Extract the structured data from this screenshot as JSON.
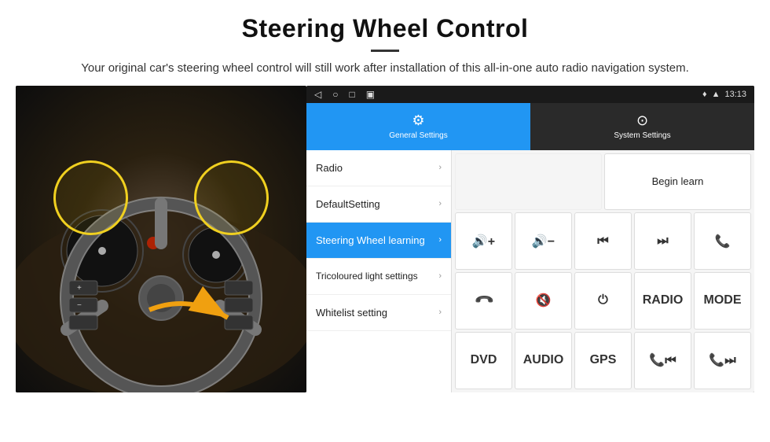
{
  "header": {
    "title": "Steering Wheel Control",
    "subtitle": "Your original car's steering wheel control will still work after installation of this all-in-one auto radio navigation system."
  },
  "statusbar": {
    "time": "13:13",
    "icons": [
      "◁",
      "○",
      "□",
      "▣"
    ]
  },
  "tabs": [
    {
      "label": "General Settings",
      "icon": "⚙",
      "active": true
    },
    {
      "label": "System Settings",
      "icon": "🔧",
      "active": false
    }
  ],
  "menu": [
    {
      "label": "Radio",
      "active": false
    },
    {
      "label": "DefaultSetting",
      "active": false
    },
    {
      "label": "Steering Wheel learning",
      "active": true
    },
    {
      "label": "Tricoloured light settings",
      "active": false
    },
    {
      "label": "Whitelist setting",
      "active": false
    }
  ],
  "buttons": {
    "begin_learn": "Begin learn",
    "row1": [
      "🔊+",
      "🔊−",
      "⏮",
      "⏭",
      "📞"
    ],
    "row2": [
      "↩",
      "🔇",
      "⏻",
      "RADIO",
      "MODE"
    ],
    "row3": [
      "DVD",
      "AUDIO",
      "GPS",
      "📞⏮",
      "📞⏭"
    ]
  }
}
